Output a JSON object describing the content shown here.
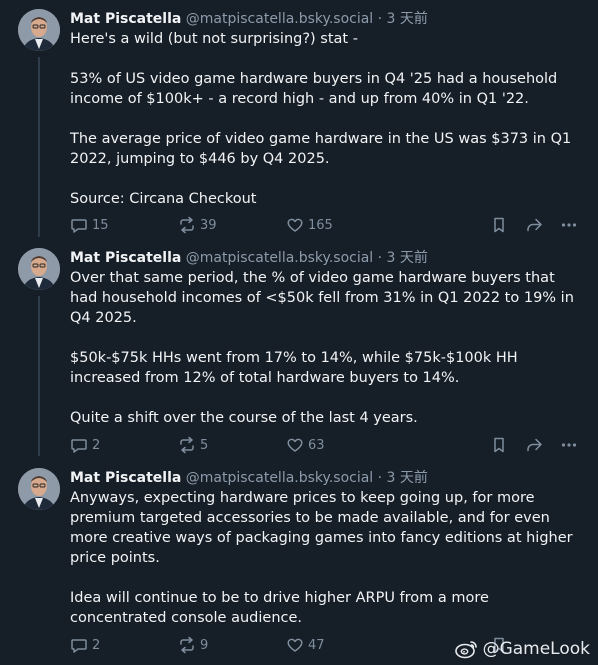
{
  "posts": [
    {
      "author": "Mat Piscatella",
      "handle": "@matpiscatella.bsky.social",
      "time": "· 3 天前",
      "paragraphs": [
        "Here's a wild (but not surprising?) stat -",
        "53% of US video game hardware buyers in Q4 '25 had a household income of $100k+ - a record high - and up from 40% in Q1 '22.",
        "The average price of video game hardware in the US was $373 in Q1 2022, jumping to $446 by Q4 2025.",
        "Source: Circana Checkout"
      ],
      "replies": "15",
      "reposts": "39",
      "likes": "165"
    },
    {
      "author": "Mat Piscatella",
      "handle": "@matpiscatella.bsky.social",
      "time": "· 3 天前",
      "paragraphs": [
        "Over that same period, the % of video game hardware buyers that had household incomes of <$50k fell from 31% in Q1 2022 to 19% in Q4 2025.",
        "$50k-$75k HHs went from 17% to 14%, while $75k-$100k HH increased from 12% of total hardware buyers to 14%.",
        "Quite a shift over the course of the last 4 years."
      ],
      "replies": "2",
      "reposts": "5",
      "likes": "63"
    },
    {
      "author": "Mat Piscatella",
      "handle": "@matpiscatella.bsky.social",
      "time": "· 3 天前",
      "paragraphs": [
        "Anyways, expecting hardware prices to keep going up, for more premium targeted accessories to be made available, and for even more creative ways of packaging games into fancy editions at higher price points.",
        "Idea will continue to be to drive higher ARPU from a more concentrated console audience."
      ],
      "replies": "2",
      "reposts": "9",
      "likes": "47"
    }
  ],
  "watermark": "@GameLook",
  "icons": {
    "reply": "speech-bubble-icon",
    "repost": "repost-arrows-icon",
    "like": "heart-icon",
    "bookmark": "bookmark-icon",
    "share": "share-arrow-icon",
    "more": "more-dots-icon",
    "watermark": "weibo-logo-icon"
  }
}
